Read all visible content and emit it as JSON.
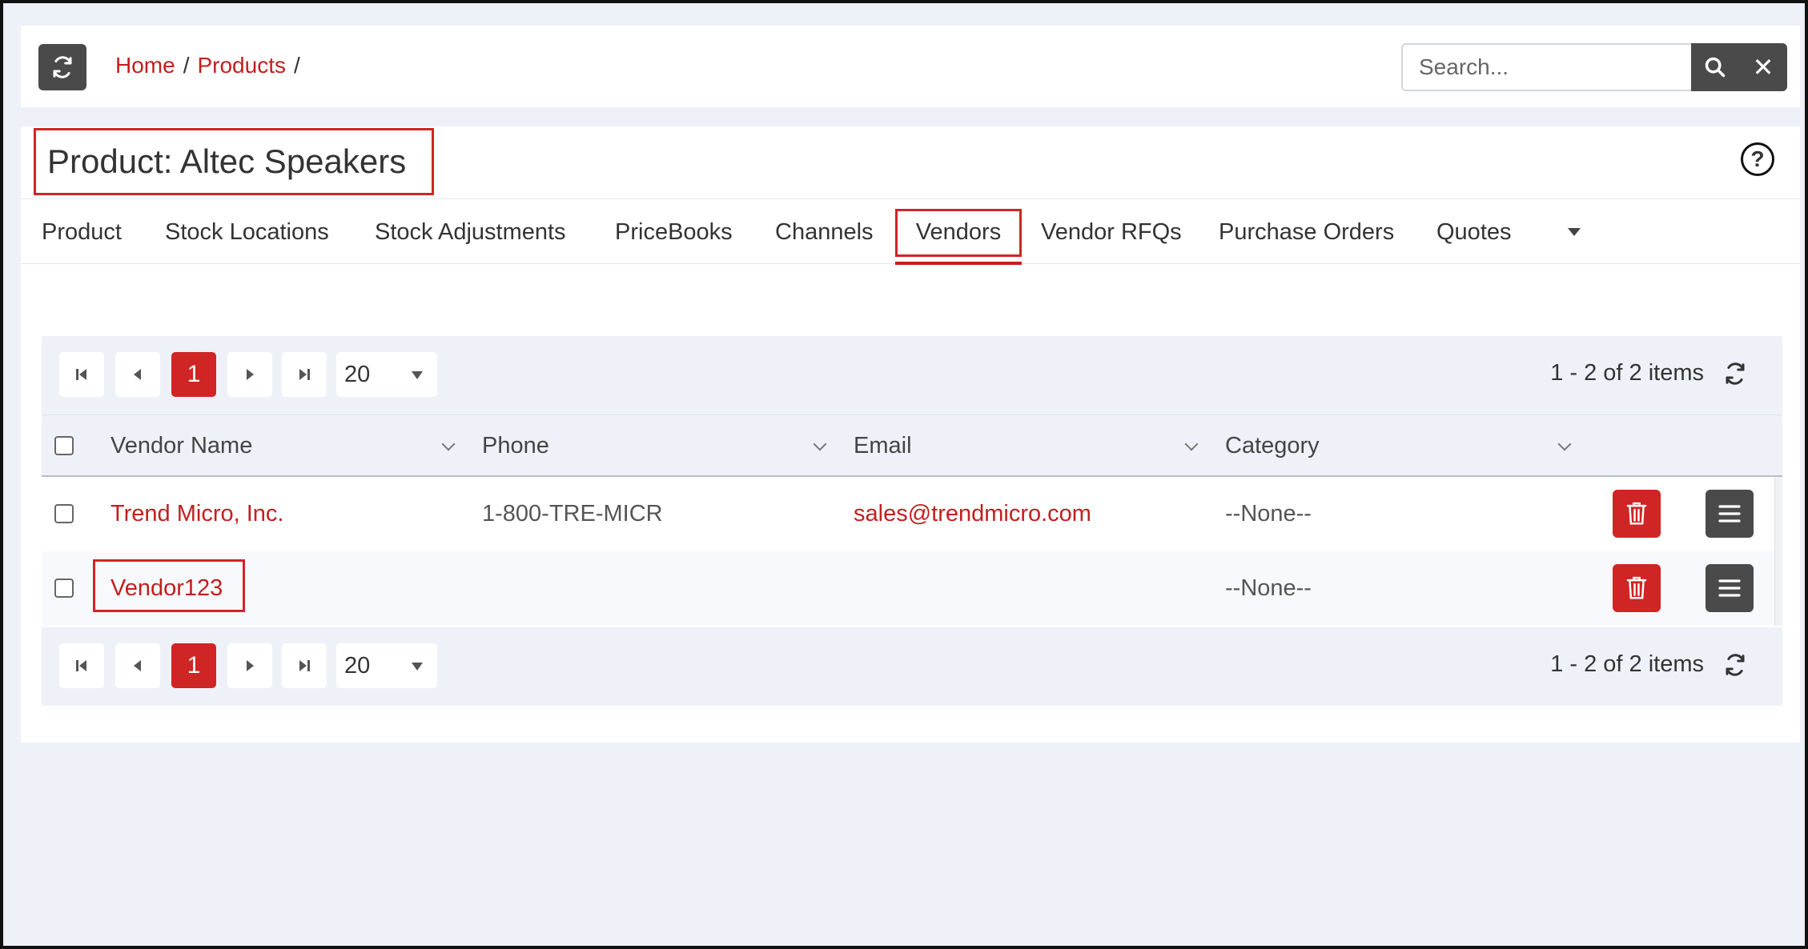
{
  "header": {
    "breadcrumb": [
      {
        "label": "Home"
      },
      {
        "label": "Products"
      }
    ],
    "separator": "/",
    "search": {
      "placeholder": "Search...",
      "clear_label": "✕"
    }
  },
  "page": {
    "title": "Product: Altec Speakers",
    "help_label": "?"
  },
  "tabs": [
    {
      "label": "Product",
      "active": false
    },
    {
      "label": "Stock Locations",
      "active": false
    },
    {
      "label": "Stock Adjustments",
      "active": false
    },
    {
      "label": "PriceBooks",
      "active": false
    },
    {
      "label": "Channels",
      "active": false
    },
    {
      "label": "Vendors",
      "active": true
    },
    {
      "label": "Vendor RFQs",
      "active": false
    },
    {
      "label": "Purchase Orders",
      "active": false
    },
    {
      "label": "Quotes",
      "active": false
    }
  ],
  "pager": {
    "current_page": "1",
    "page_size": "20",
    "info": "1 - 2 of 2 items"
  },
  "grid": {
    "columns": [
      "Vendor Name",
      "Phone",
      "Email",
      "Category"
    ],
    "rows": [
      {
        "vendor_name": "Trend Micro, Inc.",
        "phone": "1-800-TRE-MICR",
        "email": "sales@trendmicro.com",
        "category": "--None--"
      },
      {
        "vendor_name": "Vendor123",
        "phone": "",
        "email": "",
        "category": "--None--"
      }
    ]
  },
  "colors": {
    "accent": "#c41e1e",
    "dark_button": "#4a4a4a",
    "highlight_border": "#d02525"
  }
}
